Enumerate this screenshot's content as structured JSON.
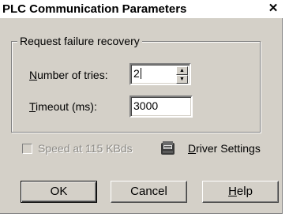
{
  "window": {
    "title": "PLC Communication Parameters",
    "close_glyph": "✕"
  },
  "group": {
    "legend": "Request failure recovery",
    "tries_label_mnemonic": "N",
    "tries_label_rest": "umber of tries:",
    "tries_value": "2",
    "timeout_label_mnemonic": "T",
    "timeout_label_rest": "imeout (ms):",
    "timeout_value": "3000"
  },
  "options": {
    "speed_label": "Speed at 115 KBds",
    "speed_checked": false,
    "speed_enabled": false
  },
  "driver": {
    "icon": "driver-settings-icon",
    "label_mnemonic": "D",
    "label_rest": "river Settings"
  },
  "buttons": {
    "ok": "OK",
    "cancel": "Cancel",
    "help_mnemonic": "H",
    "help_rest": "elp"
  },
  "colors": {
    "dialog_face": "#d4d0c8",
    "disabled_text": "#8c8a85"
  }
}
